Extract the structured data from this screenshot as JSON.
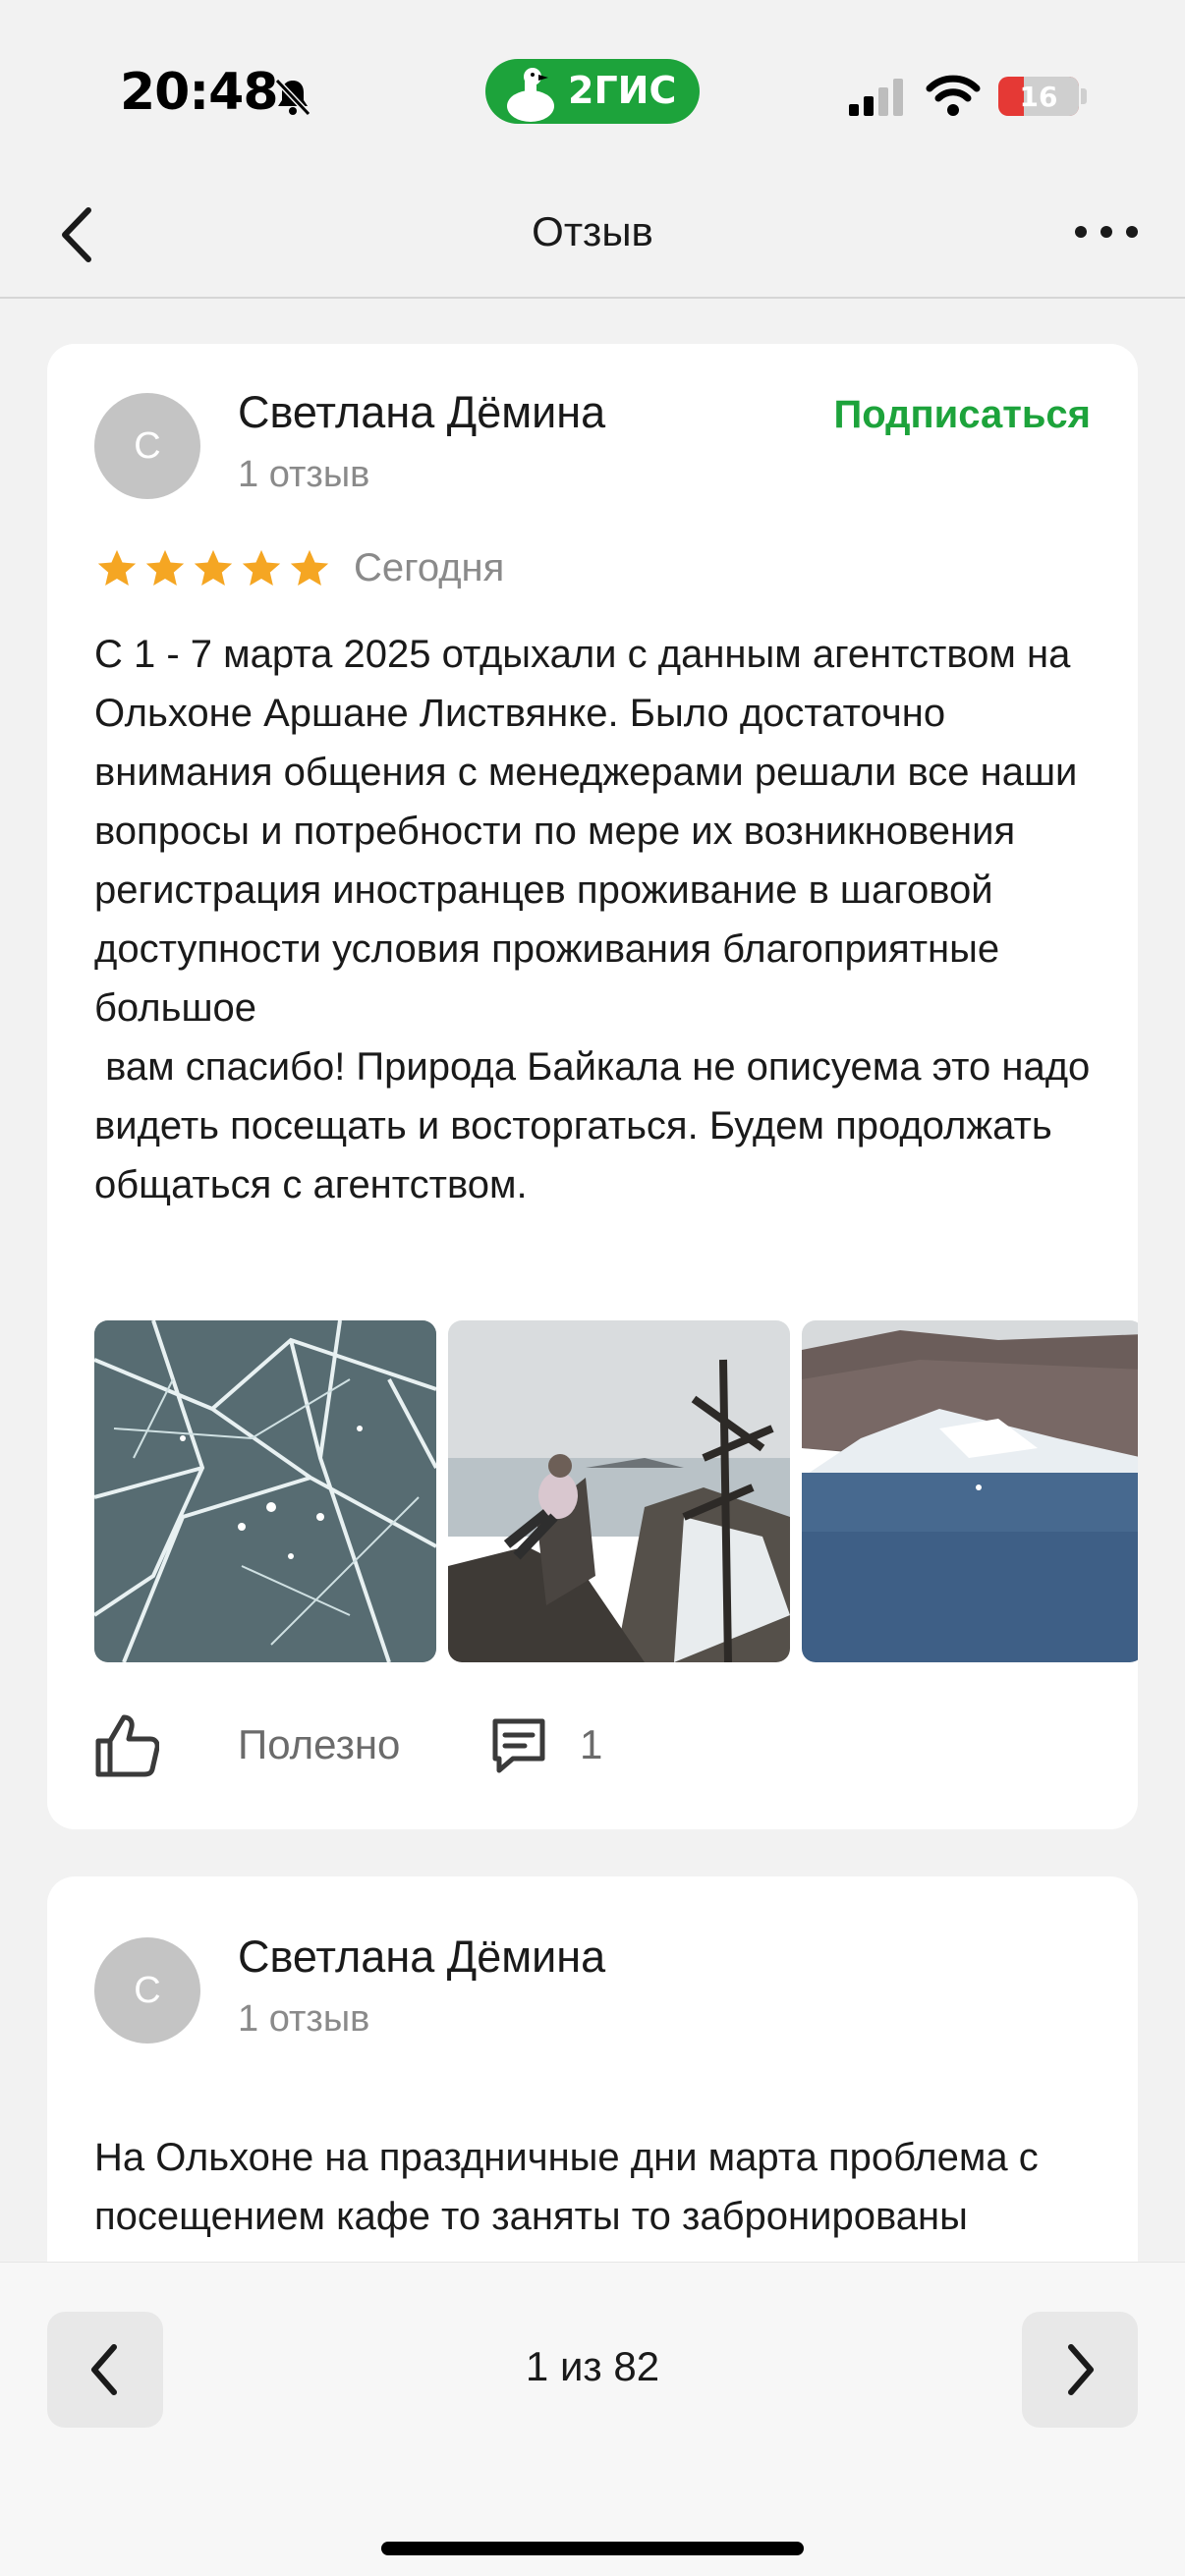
{
  "status_bar": {
    "time": "20:48",
    "brand": "2ГИС",
    "battery": "16"
  },
  "nav": {
    "title": "Отзыв"
  },
  "reviews": [
    {
      "author": "Светлана Дёмина",
      "avatar_letter": "С",
      "review_count": "1 отзыв",
      "subscribe_label": "Подписаться",
      "rating": 5,
      "date": "Сегодня",
      "text": "С 1 - 7 марта 2025 отдыхали с данным агентством на Ольхоне Аршане Листвянке. Было достаточно внимания общения с менеджерами решали все наши вопросы и потребности по мере их возникновения регистрация иностранцев проживание в шаговой доступности условия проживания благоприятные большое\n вам спасибо! Природа Байкала не описуема это надо видеть посещать и восторгаться. Будем продолжать общаться с агентством.",
      "photos": [
        "ice-photo",
        "person-on-rock-photo",
        "lake-shore-photo"
      ],
      "useful_label": "Полезно",
      "comments_count": "1"
    },
    {
      "author": "Светлана Дёмина",
      "avatar_letter": "С",
      "review_count": "1 отзыв",
      "text": "На Ольхоне на праздничные дни марта проблема с посещением кафе то заняты то забронированы выручила нас юрта ул."
    }
  ],
  "pager": {
    "label": "1 из 82"
  },
  "colors": {
    "accent_green": "#1da33b",
    "star": "#f5a623",
    "battery_low": "#e53935"
  }
}
